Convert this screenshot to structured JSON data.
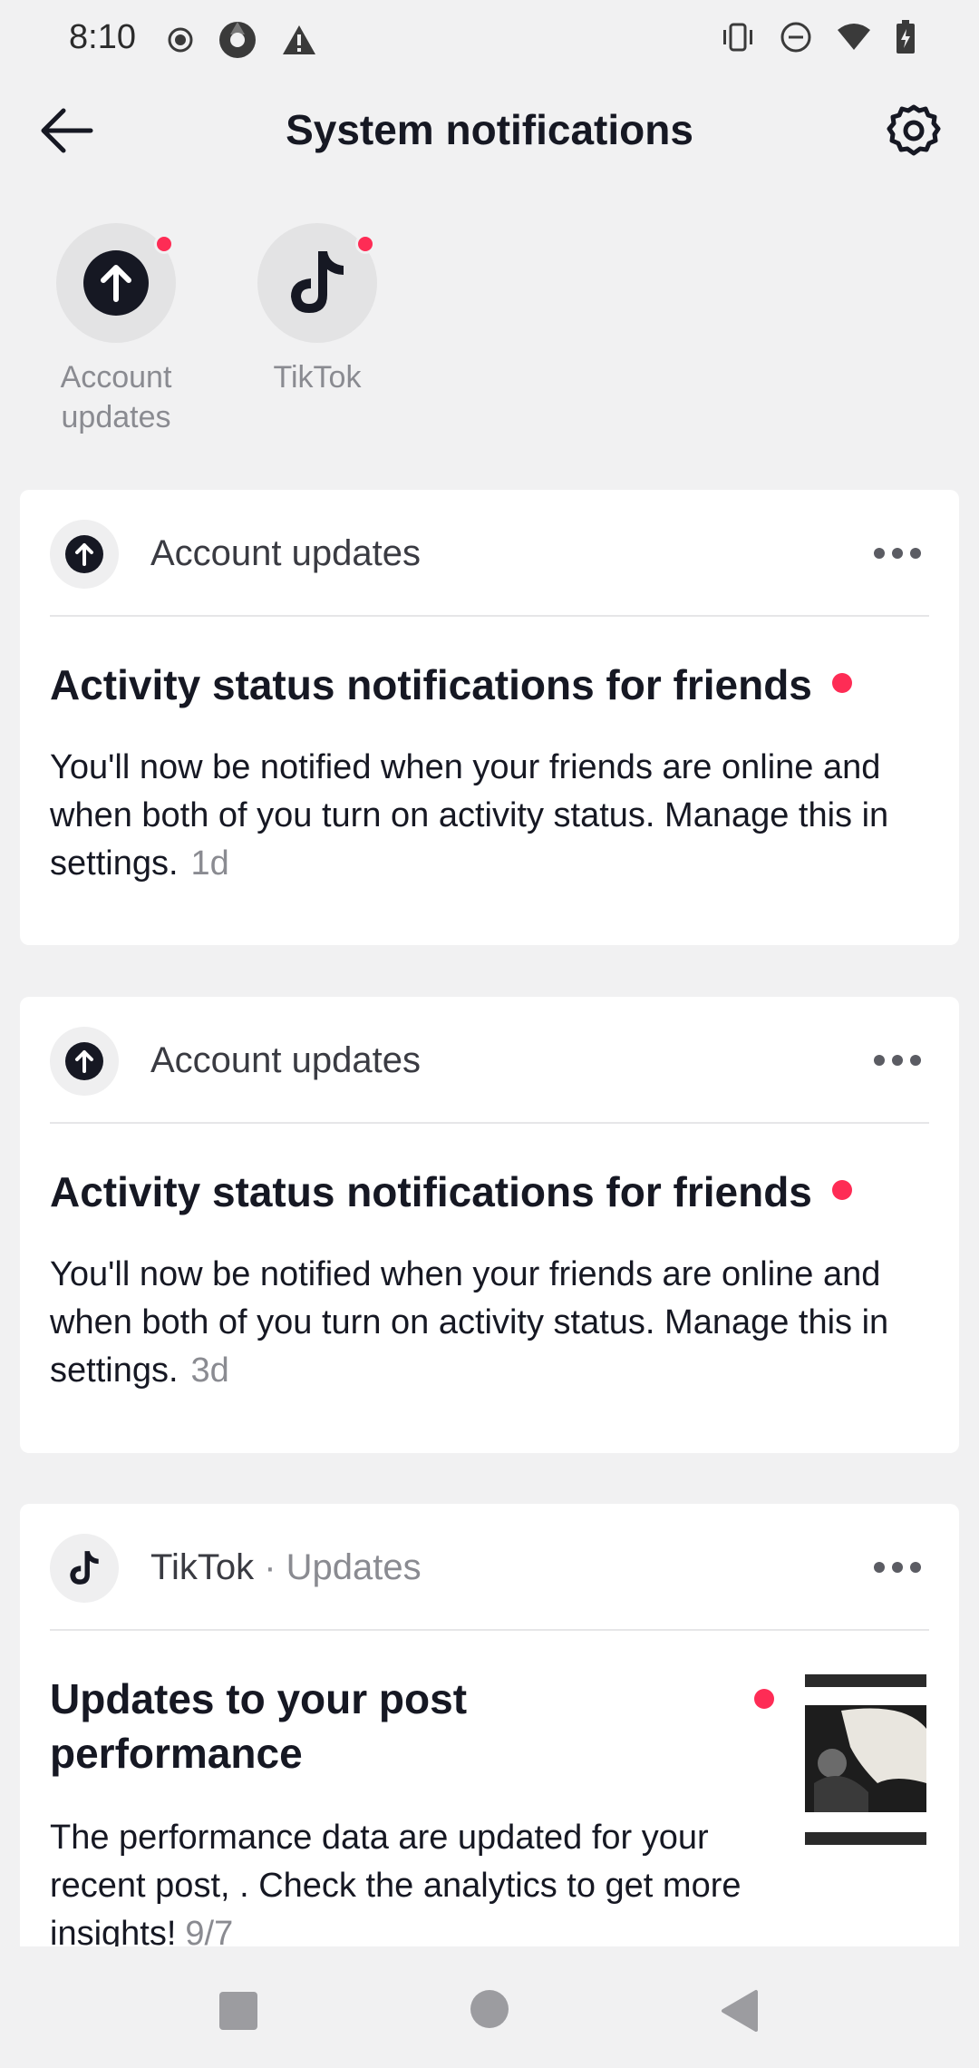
{
  "status_bar": {
    "time": "8:10",
    "left_icons": [
      "record-icon",
      "chromium-icon",
      "warning-icon"
    ],
    "right_icons": [
      "vibrate-icon",
      "dnd-icon",
      "wifi-icon",
      "battery-icon"
    ]
  },
  "header": {
    "title": "System notifications",
    "back_icon": "arrow-left-icon",
    "settings_icon": "gear-icon"
  },
  "categories": [
    {
      "label": "Account updates",
      "icon": "arrow-up-circle-icon",
      "unread": true
    },
    {
      "label": "TikTok",
      "icon": "tiktok-logo-icon",
      "unread": true
    }
  ],
  "notifications": [
    {
      "source": "Account updates",
      "title": "Activity status notifications for friends",
      "body": "You'll now be notified when your friends are online and when both of you turn on activity status. Manage this in settings.",
      "time": "1d",
      "unread": true
    },
    {
      "source": "Account updates",
      "title": "Activity status notifications for friends",
      "body": "You'll now be notified when your friends are online and when both of you turn on activity status. Manage this in settings.",
      "time": "3d",
      "unread": true
    },
    {
      "source": "TikTok",
      "source_separator": "·",
      "source_sub": "Updates",
      "title": "Updates to your post performance",
      "body": "The performance data are updated for your recent post, . Check the analytics to get more insights!",
      "time": "9/7",
      "unread": true
    }
  ],
  "colors": {
    "background": "#f1f1f2",
    "card": "#ffffff",
    "unread_dot": "#fe2c55",
    "text_primary": "#161823",
    "text_secondary": "#8a8b91"
  }
}
